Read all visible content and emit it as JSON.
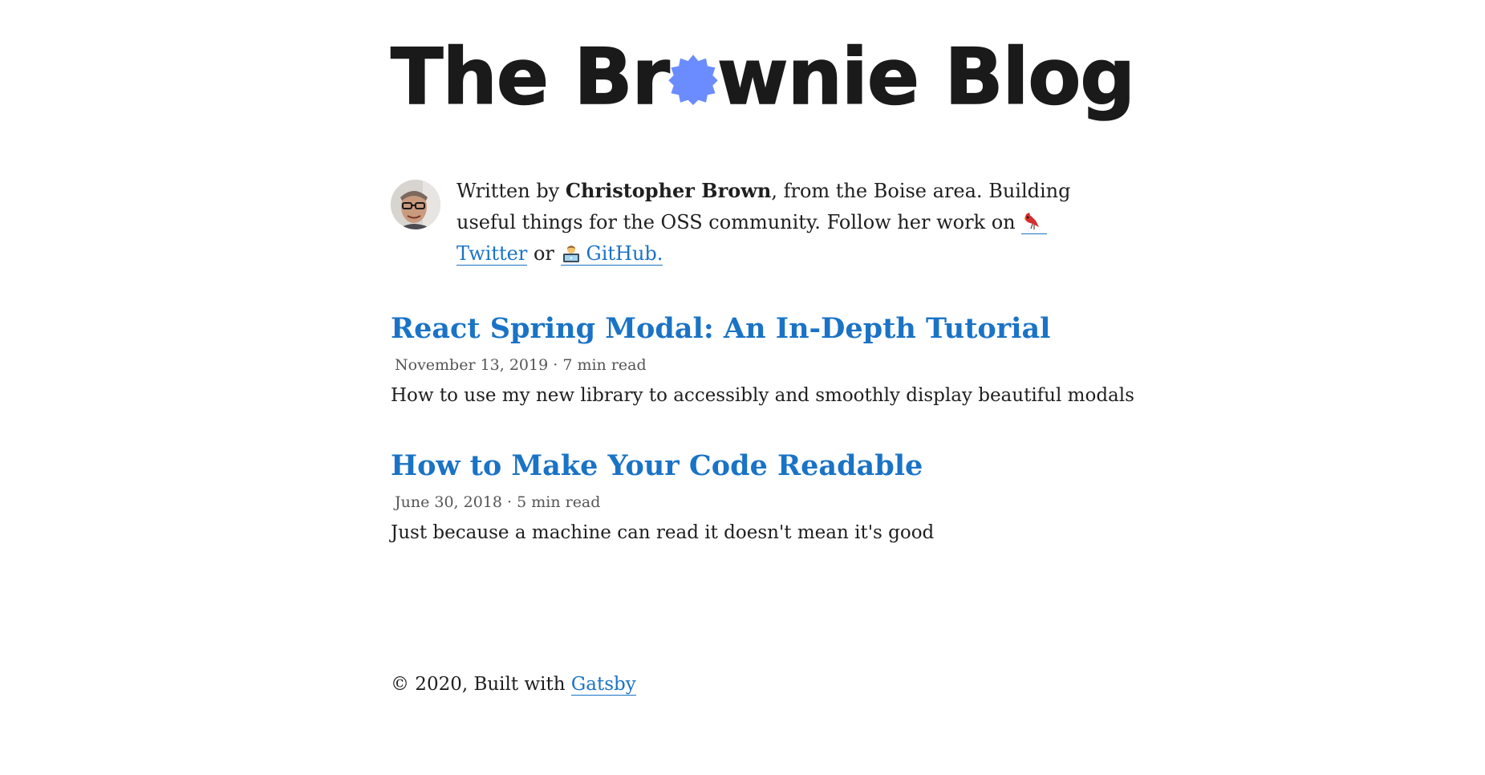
{
  "site": {
    "title_before": "The Br",
    "title_after": "wnie Blog",
    "badge_color": "#6b8cff"
  },
  "bio": {
    "prefix": "Written by ",
    "author": "Christopher Brown",
    "middle": ", from the Boise area. Building useful things for the OSS community. Follow her work on ",
    "twitter_label": "Twitter",
    "or": " or ",
    "github_label": "GitHub."
  },
  "posts": [
    {
      "title": "React Spring Modal: An In-Depth Tutorial",
      "date": "November 13, 2019",
      "read_time": "7 min read",
      "excerpt": "How to use my new library to accessibly and smoothly display beautiful modals"
    },
    {
      "title": "How to Make Your Code Readable",
      "date": "June 30, 2018",
      "read_time": "5 min read",
      "excerpt": "Just because a machine can read it doesn't mean it's good"
    }
  ],
  "meta_separator": " · ",
  "footer": {
    "text": "© 2020, Built with ",
    "link_label": "Gatsby"
  },
  "colors": {
    "link": "#1a73c6",
    "text": "#1f1f1f",
    "meta": "#555555"
  },
  "icons": [
    "blue-badge-icon",
    "avatar",
    "cardinal-bird-emoji-icon",
    "technologist-emoji-icon"
  ]
}
